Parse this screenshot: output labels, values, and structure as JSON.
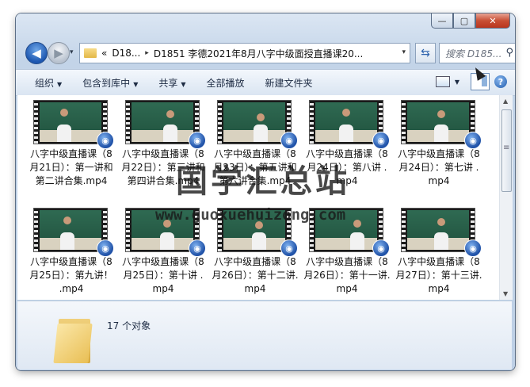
{
  "window": {
    "minimize_glyph": "—",
    "maximize_glyph": "▢",
    "close_glyph": "✕"
  },
  "nav": {
    "back_glyph": "◀",
    "forward_glyph": "▶",
    "address_prefix": "«",
    "address_segment1": "D18...",
    "address_separator": "▸",
    "address_segment2": "D1851 李德2021年8月八字中级面授直播课20...",
    "address_dropdown": "▾",
    "refresh_glyph": "⇆",
    "search_placeholder": "搜索 D185...",
    "search_icon": "⚲"
  },
  "toolbar": {
    "organize": "组织",
    "include_library": "包含到库中",
    "share": "共享",
    "play_all": "全部播放",
    "new_folder": "新建文件夹",
    "caret": "▼",
    "help": "?"
  },
  "files": [
    {
      "name": "八字中级直播课（8月21日）：第一讲和第二讲合集.mp4"
    },
    {
      "name": "八字中级直播课（8月22日）：第三讲和第四讲合集.mp4"
    },
    {
      "name": "八字中级直播课（8月23日）：第五讲和第六讲合集.mp4"
    },
    {
      "name": "八字中级直播课（8月24日）：第八讲 .mp4"
    },
    {
      "name": "八字中级直播课（8月24日）：第七讲 .mp4"
    },
    {
      "name": "八字中级直播课（8月25日）：第九讲！ .mp4"
    },
    {
      "name": "八字中级直播课（8月25日）：第十讲 .mp4"
    },
    {
      "name": "八字中级直播课（8月26日）：第十二讲.mp4"
    },
    {
      "name": "八字中级直播课（8月26日）：第十一讲.mp4"
    },
    {
      "name": "八字中级直播课（8月27日）：第十三讲.mp4"
    }
  ],
  "badge_glyph": "◉",
  "details": {
    "count": "17 个对象"
  },
  "watermark": {
    "line1": "国学汇总站",
    "line2": "www.guoxuehuizong.com"
  },
  "scroll": {
    "up": "▲",
    "down": "▼"
  }
}
